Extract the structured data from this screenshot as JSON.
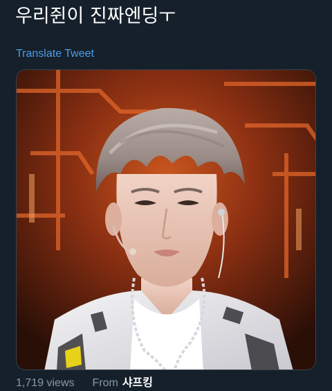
{
  "tweet": {
    "text": "우리쥔이 진짜엔딩ㅜ",
    "translate_label": "Translate Tweet",
    "views": "1,719 views",
    "from_label": "From",
    "source": "샤프킹"
  },
  "colors": {
    "background": "#15202b",
    "link": "#4c9eeb",
    "muted": "#8899a6",
    "border": "#38444d"
  }
}
